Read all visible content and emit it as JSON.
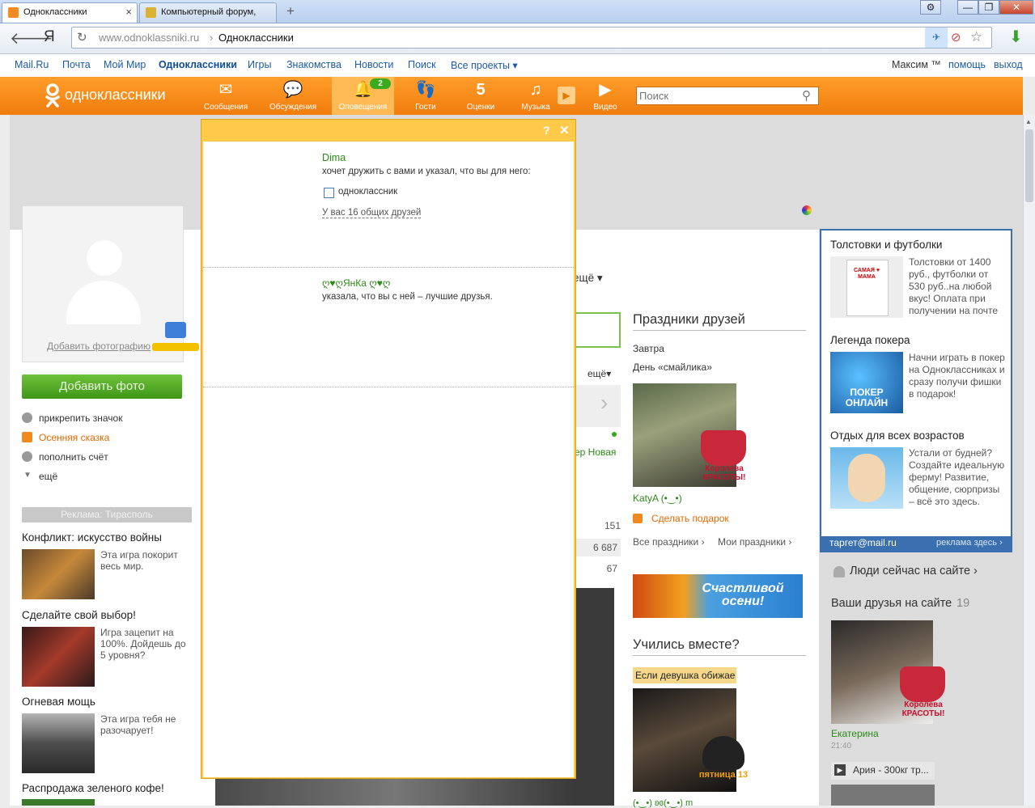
{
  "browser": {
    "tabs": [
      {
        "title": "Одноклассники",
        "active": true
      },
      {
        "title": "Компьютерный форум,",
        "active": false
      }
    ],
    "new_tab": "+",
    "window_buttons": [
      "⚙",
      "—",
      "❐",
      "✕"
    ],
    "url_host": "www.odnoklassniki.ru",
    "url_sep": "›",
    "url_page_title": "Одноклассники",
    "yandex_logo": "Я"
  },
  "mailru_bar": {
    "links": [
      "Mail.Ru",
      "Почта",
      "Мой Мир",
      "Одноклассники",
      "Игры",
      "Знакомства",
      "Новости",
      "Поиск",
      "Все проекты ▾"
    ],
    "user": "Максим ™",
    "help": "помощь",
    "logout": "выход"
  },
  "header": {
    "logo_text": "одноклассники",
    "nav": [
      {
        "label": "Сообщения",
        "icon": "✉"
      },
      {
        "label": "Обсуждения",
        "icon": "💬"
      },
      {
        "label": "Оповещения",
        "icon": "🔔",
        "badge": "2",
        "active": true
      },
      {
        "label": "Гости",
        "icon": "👣"
      },
      {
        "label": "Оценки",
        "icon": "5"
      },
      {
        "label": "Музыка",
        "icon": "♫"
      },
      {
        "label": "Видео",
        "icon": "▶"
      }
    ],
    "search_placeholder": "Поиск"
  },
  "left": {
    "add_photo_link": "Добавить фотографию",
    "add_photo_button": "Добавить фото",
    "actions": [
      "прикрепить значок",
      "Осенняя сказка",
      "пополнить счёт",
      "ещё"
    ],
    "ads_title": "Реклама: Тирасполь",
    "ads": [
      {
        "title": "Конфликт: искусство войны",
        "text": "Эта игра покорит весь мир."
      },
      {
        "title": "Сделайте свой выбор!",
        "text": "Игра зацепит на 100%. Дойдешь до 5 уровня?"
      },
      {
        "title": "Огневая мощь",
        "text": "Эта игра тебя не разочарует!"
      },
      {
        "title": "Распродажа зеленого кофе!",
        "text": ""
      }
    ]
  },
  "middle": {
    "more": "ещё ▾",
    "more2": "ещё▾",
    "name_fragment": "ер Новая",
    "stats": [
      "151",
      "6 687",
      "67"
    ]
  },
  "holidays": {
    "title": "Праздники друзей",
    "tomorrow": "Завтра",
    "holiday_name": "День «смайлика»",
    "friend_name": "KatyA (•‿•)",
    "gift": "Сделать подарок",
    "all": "Все праздники ›",
    "mine": "Мои праздники ›",
    "banner": "Счастливой осени!",
    "queen_badge": "Королева КРАСОТЫ!"
  },
  "studied": {
    "title": "Учились вместе?",
    "caption": "Если девушка обижае",
    "badge": "пятница 13",
    "bottom_name": "(•‿•) ʚɞ(•‿•) m"
  },
  "right_ads": {
    "items": [
      {
        "title": "Толстовки и футболки",
        "text": "Толстовки от 1400 руб., футболки от 530 руб..на любой вкус! Оплата при получении на почте"
      },
      {
        "title": "Легенда покера",
        "text": "Начни играть в покер на Одноклассниках и сразу получи фишки в подарок!"
      },
      {
        "title": "Отдых для всех возрастов",
        "text": "Устали от будней? Создайте идеальную ферму! Развитие, общение, сюрпризы – всё это здесь."
      }
    ],
    "tshirt_text": "САМАЯ ♥ МАМА",
    "poker_text": "ПОКЕР ОНЛАЙН",
    "target": "таргет@mail.ru",
    "ad_here": "реклама здесь ›"
  },
  "online": {
    "people": "Люди сейчас на сайте ›",
    "friends_label": "Ваши друзья на сайте",
    "friends_count": "19",
    "friend_name": "Екатерина",
    "friend_time": "21:40",
    "song": "Ария - 300кг тр..."
  },
  "popup": {
    "help": "?",
    "close": "✕",
    "n1_name": "Dima",
    "n1_text": "хочет дружить с вами и указал, что вы для него:",
    "n1_checkbox": "одноклассник",
    "n1_mutual": "У вас 16 общих друзей",
    "n2_name": "ღ♥ღЯнКа ღ♥ღ",
    "n2_text": "указала, что вы с ней – лучшие друзья."
  },
  "colors": {
    "orange": "#f58a1f",
    "green": "#2a8a16",
    "popup_yellow": "#ffc94a"
  }
}
